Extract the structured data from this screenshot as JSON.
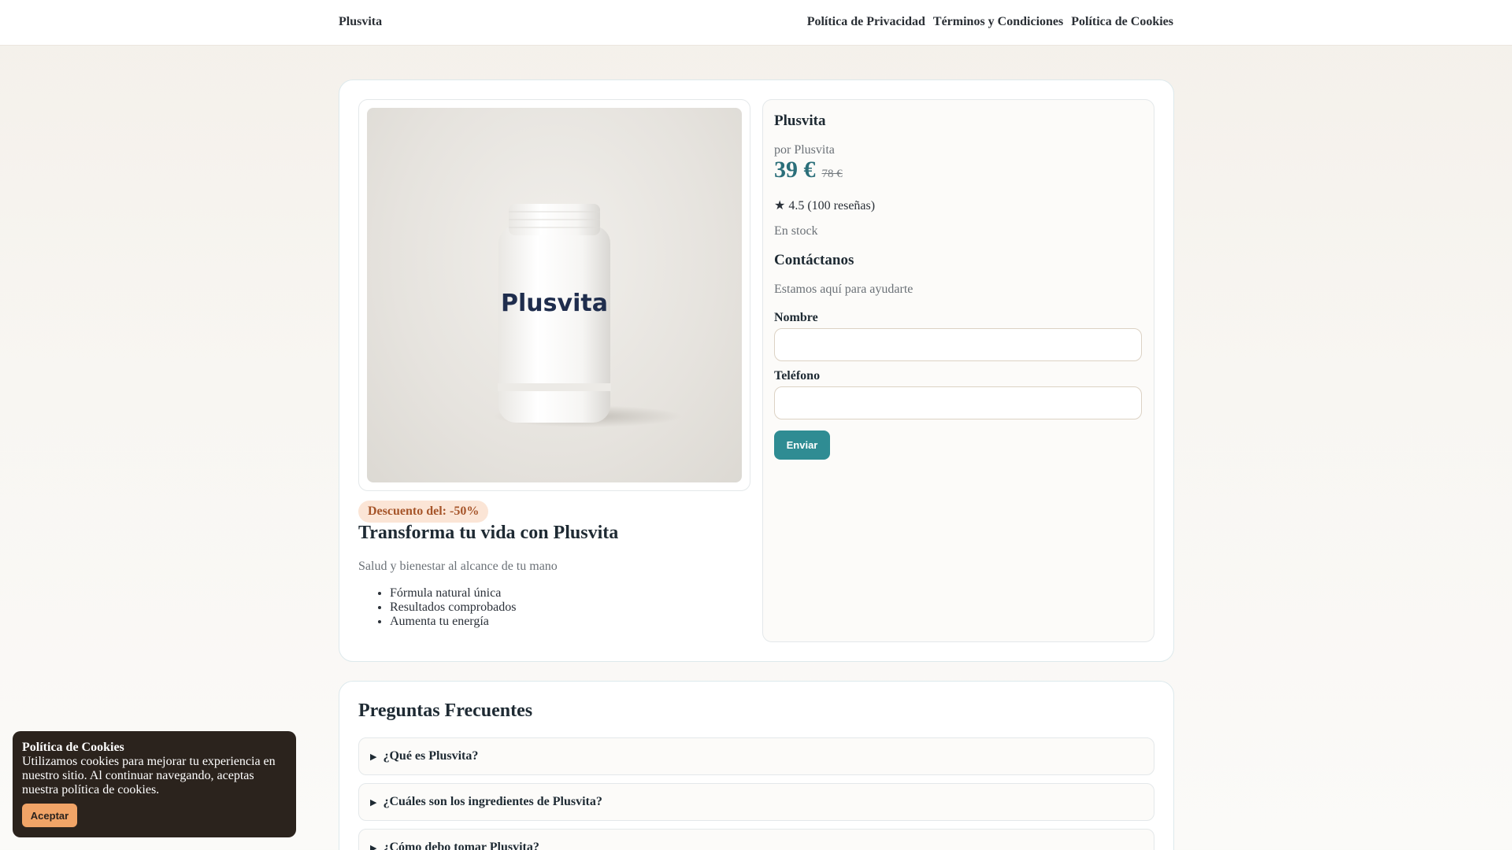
{
  "header": {
    "brand": "Plusvita",
    "nav": [
      "Política de Privacidad",
      "Términos y Condiciones",
      "Política de Cookies"
    ]
  },
  "product": {
    "image_label": "Plusvita",
    "discount_badge": "Descuento del: -50%",
    "headline": "Transforma tu vida con Plusvita",
    "subline": "Salud y bienestar al alcance de tu mano",
    "features": [
      "Fórmula natural única",
      "Resultados comprobados",
      "Aumenta tu energía"
    ]
  },
  "info": {
    "title": "Plusvita",
    "by": "por Plusvita",
    "price_now": "39 €",
    "price_old": "78 €",
    "rating": "★ 4.5 (100 reseñas)",
    "stock": "En stock",
    "contact_title": "Contáctanos",
    "contact_help": "Estamos aquí para ayudarte",
    "name_label": "Nombre",
    "name_value": "",
    "phone_label": "Teléfono",
    "phone_value": "",
    "send_label": "Enviar"
  },
  "faq": {
    "title": "Preguntas Frecuentes",
    "items": [
      "¿Qué es Plusvita?",
      "¿Cuáles son los ingredientes de Plusvita?",
      "¿Cómo debo tomar Plusvita?"
    ]
  },
  "cookie": {
    "title": "Política de Cookies",
    "text": "Utilizamos cookies para mejorar tu experiencia en nuestro sitio. Al continuar navegando, aceptas nuestra política de cookies.",
    "accept_label": "Aceptar"
  },
  "colors": {
    "accent": "#2f8c93",
    "price": "#2b6f7a",
    "badge_bg": "#fbe5d6",
    "badge_text": "#a6552a",
    "cookie_bg": "#2b231d",
    "cookie_button": "#f1a467"
  },
  "icons": {
    "rating": "star-icon",
    "faq_toggle": "triangle-right-icon"
  }
}
